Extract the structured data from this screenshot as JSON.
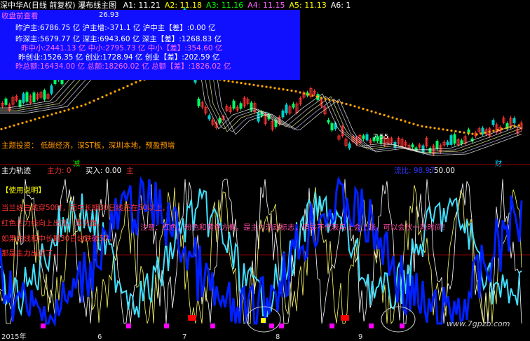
{
  "header": {
    "title": "深中华A(日线 前复权) 瀑布线主图",
    "readouts": [
      {
        "label": "A1: 11.21",
        "color": "#ffffff"
      },
      {
        "label": "A2: 11.18",
        "color": "#ffff00"
      },
      {
        "label": "A3: 11.16",
        "color": "#00ff00"
      },
      {
        "label": "A4: 11.15",
        "color": "#ff66ff"
      },
      {
        "label": "A5: 11.13",
        "color": "#ffff00"
      },
      {
        "label": "A6: 1",
        "color": "#ffffff"
      }
    ],
    "price_high": "26.93",
    "price_low": "7.55"
  },
  "info_panel": {
    "heading": "收盘前查看",
    "lines": [
      {
        "text": "昨沪主:6786.75 亿 沪主增:-371.1 亿 沪中主【差】:0.00 亿",
        "color": "#ffffff"
      },
      {
        "text": "昨深主:5679.77 亿 深主:6943.60 亿 深主【差】:1268.83 亿",
        "color": "#ffffff"
      },
      {
        "text": "昨中小:2441.13 亿 中小:2795.73 亿 中小【差】:354.60 亿",
        "color": "#ff66ff"
      },
      {
        "text": "昨创业:1526.35 亿 创业:1728.94 亿 创业【差】:202.59 亿",
        "color": "#ffffff"
      },
      {
        "text": "昨总额:16434.00 亿 总额:18260.02 亿 总额【差】:1826.02 亿",
        "color": "#ff66ff"
      }
    ]
  },
  "theme": "主题投资：  低碳经济，深ST板，深圳本地，预盈预增",
  "markers": {
    "jian": "减",
    "cai": "财"
  },
  "sub_panel": {
    "name": "主力轨迹",
    "zhuli": "主力: 0",
    "mairu": "买入: 0.00",
    "zhu": "主",
    "right_label": "流比: 98.97",
    "right_value": ": 50.00"
  },
  "notes": {
    "heading": "【使用说明】",
    "lines": [
      "当兰线白线穿50时，而中长期30日线还在50以上，",
      "红色主力线向上出货，是洗盘。",
      "如果白线和中长期30日线跌破50，",
      "那是主力出货了。"
    ],
    "middle": "注意：红色，粉色和黄色方框，是主力活动标志，但是不代表马上会上涨，可以会伏一段时间！"
  },
  "axis": {
    "labels": [
      "2015年",
      "6",
      "7",
      "8",
      "9"
    ]
  },
  "watermark": "www.7gpzb.com",
  "colors": {
    "up": "#ff3333",
    "down": "#00cccc",
    "dots": "#ffa500",
    "info_bg": "#1010ff",
    "line_blue": "#0020ff",
    "line_cyan": "#40e0ff",
    "line_yellow": "#ffff66",
    "line_white": "#ffffff",
    "line_magenta": "#ff00ff"
  }
}
